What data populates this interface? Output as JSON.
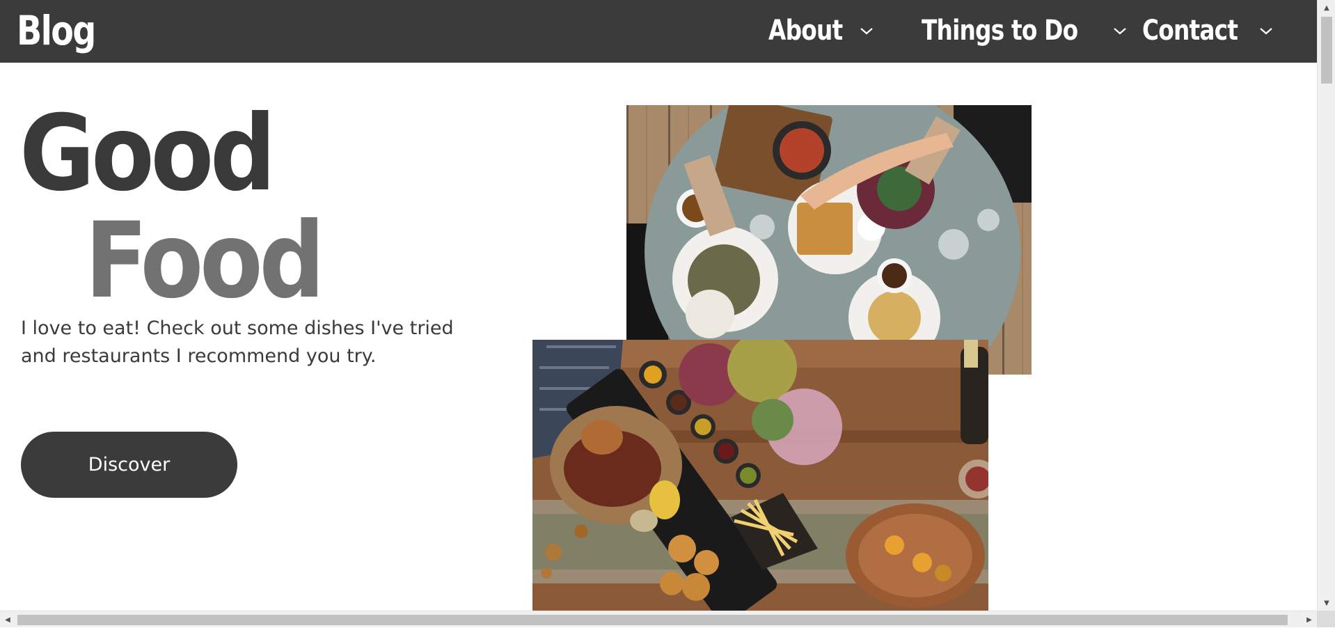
{
  "header": {
    "brand": "Blog",
    "nav": [
      {
        "label": "About",
        "icon": "chevron-down-icon"
      },
      {
        "label": "Things to Do",
        "icon": "chevron-down-icon"
      },
      {
        "label": "Contact",
        "icon": "chevron-down-icon"
      }
    ]
  },
  "hero": {
    "title_line1": "Good",
    "title_line2": "Food",
    "intro": "I love to eat! Check out some dishes I've tried and restaurants I recommend you try.",
    "cta_label": "Discover"
  },
  "images": {
    "top": {
      "icon": "food-table-photo"
    },
    "bottom": {
      "icon": "grill-platter-photo"
    }
  },
  "colors": {
    "header_bg": "#3b3b3b",
    "title_dark": "#3a3a3a",
    "title_light": "#727272",
    "button_bg": "#3b3b3b"
  }
}
